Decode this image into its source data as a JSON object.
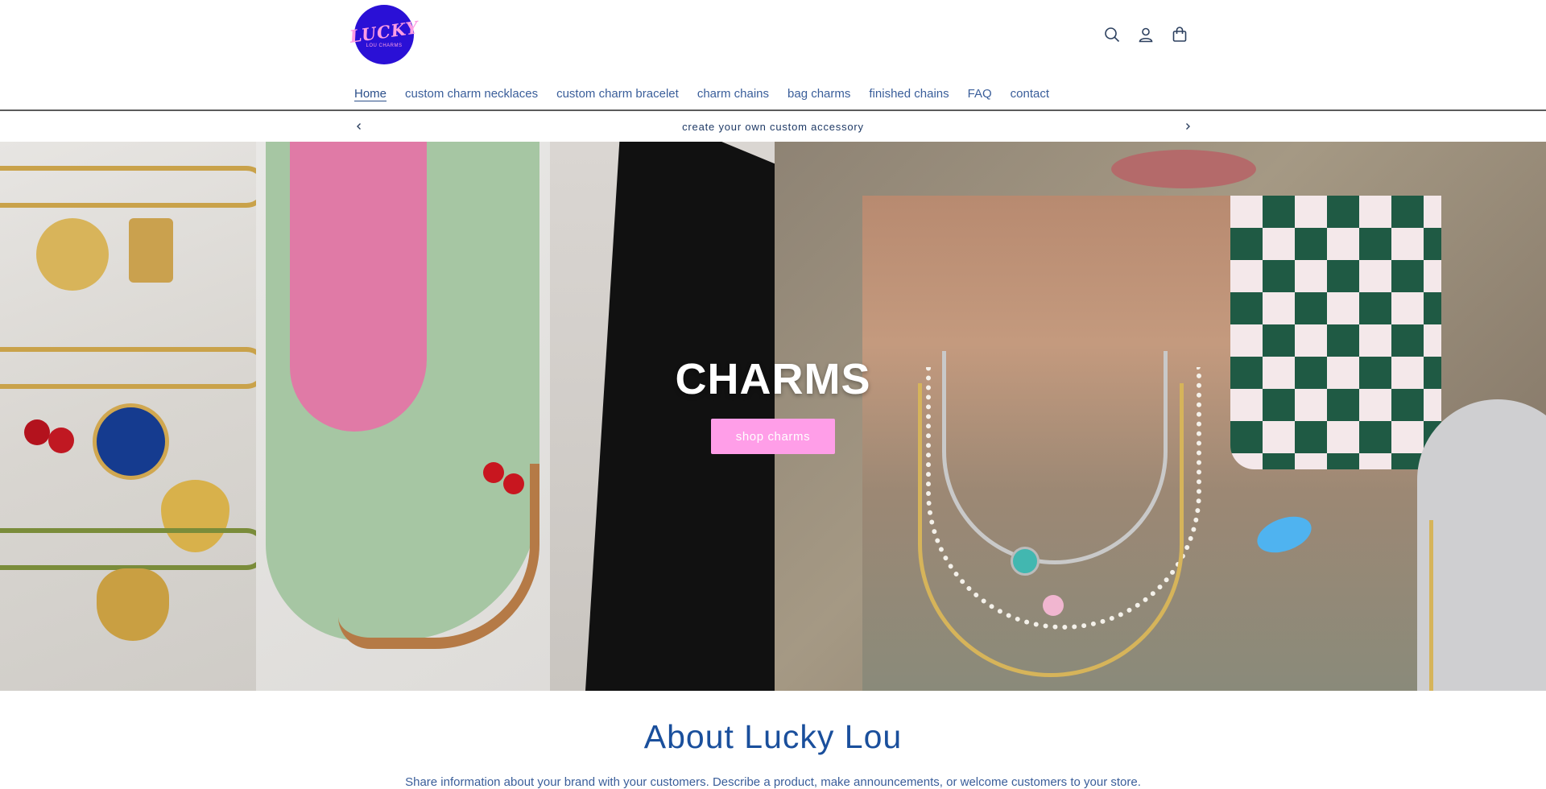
{
  "header": {
    "logo_text": "LUCKY",
    "logo_subtext": "LOU CHARMS",
    "icons": [
      "search-icon",
      "account-icon",
      "cart-icon"
    ]
  },
  "nav": {
    "items": [
      {
        "label": "Home"
      },
      {
        "label": "custom charm necklaces"
      },
      {
        "label": "custom charm bracelet"
      },
      {
        "label": "charm chains"
      },
      {
        "label": "bag charms"
      },
      {
        "label": "finished chains"
      },
      {
        "label": "FAQ"
      },
      {
        "label": "contact"
      }
    ],
    "active": "Home"
  },
  "announcement": {
    "text": "create your own custom accessory"
  },
  "hero": {
    "title": "CHARMS",
    "button_label": "shop charms"
  },
  "about": {
    "title": "About Lucky Lou",
    "text": "Share information about your brand with your customers. Describe a product, make announcements, or welcome customers to your store."
  },
  "colors": {
    "logo_bg": "#2a10d6",
    "logo_text": "#ff9ee3",
    "button_bg": "#ff9ee8",
    "heading": "#1a4f9c",
    "nav_text": "#3a5e9a"
  }
}
